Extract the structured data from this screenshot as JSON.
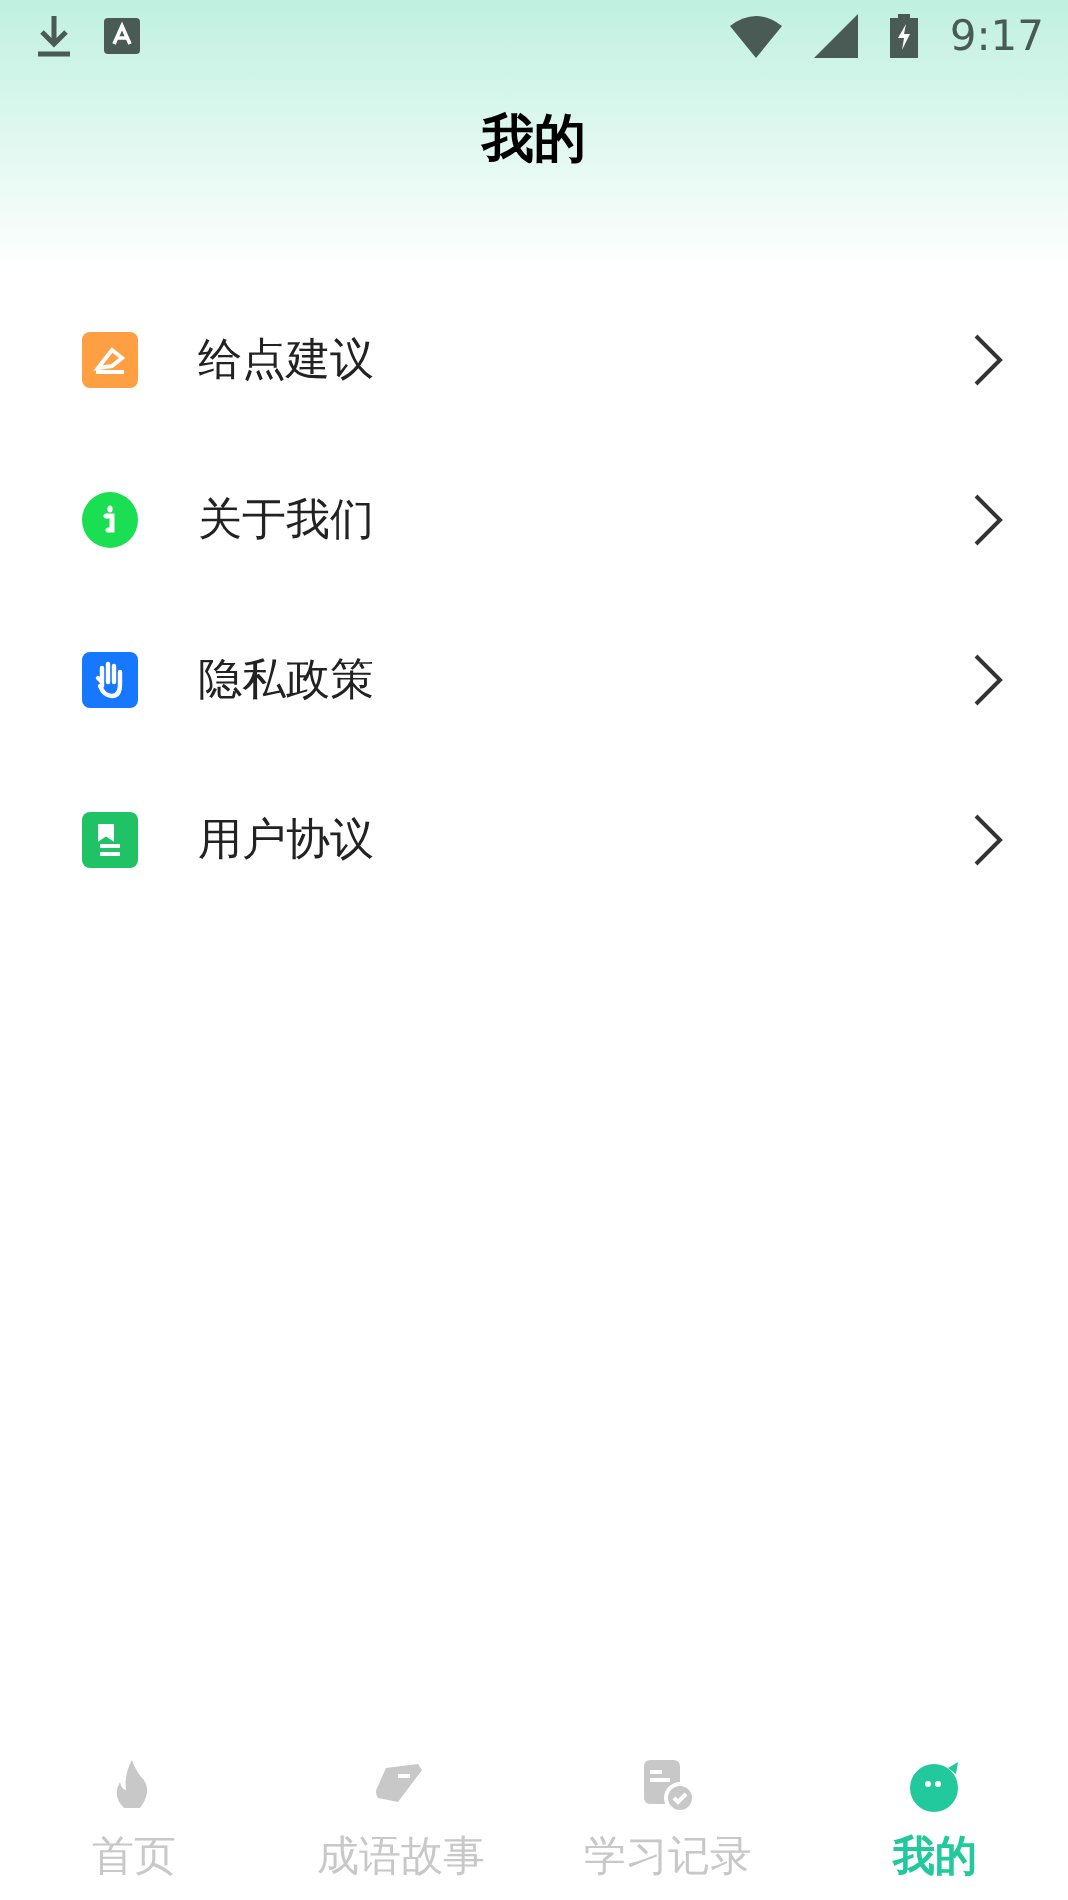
{
  "status_bar": {
    "time": "9:17"
  },
  "header": {
    "title": "我的"
  },
  "menu": [
    {
      "label": "给点建议",
      "kind": "feedback",
      "color": "#ff9f43"
    },
    {
      "label": "关于我们",
      "kind": "info",
      "color": "#1adf52"
    },
    {
      "label": "隐私政策",
      "kind": "hand",
      "color": "#1677ff"
    },
    {
      "label": "用户协议",
      "kind": "document",
      "color": "#1fc265"
    }
  ],
  "tabs": [
    {
      "label": "首页",
      "kind": "home",
      "selected": false
    },
    {
      "label": "成语故事",
      "kind": "book",
      "selected": false
    },
    {
      "label": "学习记录",
      "kind": "record",
      "selected": false
    },
    {
      "label": "我的",
      "kind": "me",
      "selected": true
    }
  ]
}
